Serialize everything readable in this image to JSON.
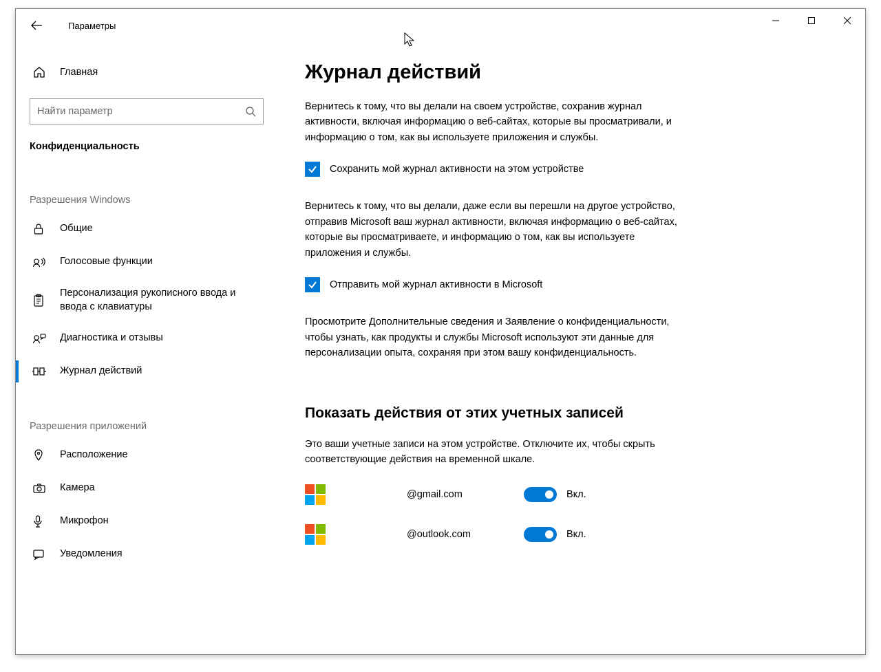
{
  "window": {
    "title": "Параметры"
  },
  "sidebar": {
    "home": "Главная",
    "search_placeholder": "Найти параметр",
    "category": "Конфиденциальность",
    "group1": "Разрешения Windows",
    "group2": "Разрешения приложений",
    "items1": [
      {
        "label": "Общие"
      },
      {
        "label": "Голосовые функции"
      },
      {
        "label": "Персонализация рукописного ввода и ввода с клавиатуры"
      },
      {
        "label": "Диагностика и отзывы"
      },
      {
        "label": "Журнал действий"
      }
    ],
    "items2": [
      {
        "label": "Расположение"
      },
      {
        "label": "Камера"
      },
      {
        "label": "Микрофон"
      },
      {
        "label": "Уведомления"
      }
    ]
  },
  "main": {
    "heading": "Журнал действий",
    "para1": "Вернитесь к тому, что вы делали на своем устройстве, сохранив журнал активности, включая информацию о веб-сайтах, которые вы просматривали, и информацию о том, как вы используете приложения и службы.",
    "check1": "Сохранить мой журнал активности на этом устройстве",
    "para2": "Вернитесь к тому, что вы делали, даже если вы перешли на другое устройство, отправив Microsoft ваш журнал активности, включая информацию о веб-сайтах, которые вы просматриваете, и информацию о том, как вы используете приложения и службы.",
    "check2": "Отправить мой журнал активности в Microsoft",
    "para3": "Просмотрите Дополнительные сведения и Заявление о конфиденциальности, чтобы узнать, как продукты и службы Microsoft используют эти данные для персонализации опыта, сохраняя при этом вашу конфиденциальность.",
    "accounts_heading": "Показать действия от этих учетных записей",
    "accounts_para": "Это ваши учетные записи на этом устройстве. Отключите их, чтобы скрыть соответствующие действия на временной шкале.",
    "accounts": [
      {
        "email": "@gmail.com",
        "state": "Вкл."
      },
      {
        "email": "@outlook.com",
        "state": "Вкл."
      }
    ]
  }
}
